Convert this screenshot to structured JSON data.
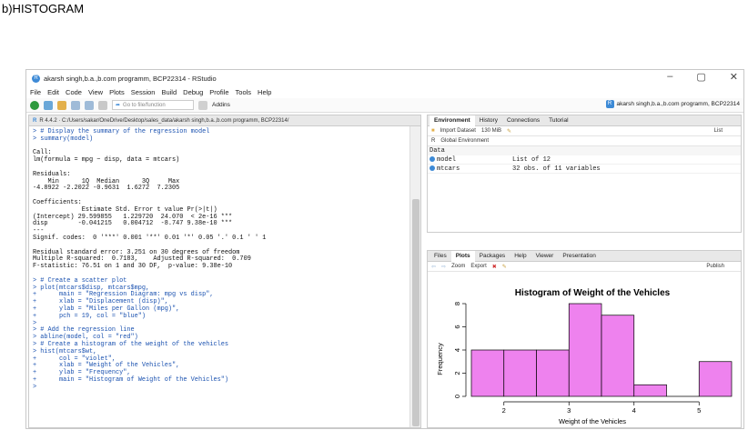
{
  "doc_heading": "b)HISTOGRAM",
  "window": {
    "title": "akarsh singh,b.a.,b.com programm, BCP22314 - RStudio",
    "controls": [
      "–",
      "▢",
      "✕"
    ]
  },
  "menu": [
    "File",
    "Edit",
    "Code",
    "View",
    "Plots",
    "Session",
    "Build",
    "Debug",
    "Profile",
    "Tools",
    "Help"
  ],
  "toolbar": {
    "goto_placeholder": "Go to file/function",
    "addins": "Addins",
    "project": "akarsh singh,b.a.,b.com programm, BCP22314"
  },
  "console": {
    "header": "R 4.4.2 · C:/Users/sakar/OneDrive/Desktop/sales_data/akarsh singh,b.a.,b.com programm, BCP22314/",
    "lines": [
      {
        "t": "> # Display the summary of the regression model",
        "k": "in"
      },
      {
        "t": "> summary(model)",
        "k": "in"
      },
      {
        "t": "",
        "k": "out"
      },
      {
        "t": "Call:",
        "k": "out"
      },
      {
        "t": "lm(formula = mpg ~ disp, data = mtcars)",
        "k": "out"
      },
      {
        "t": "",
        "k": "out"
      },
      {
        "t": "Residuals:",
        "k": "out"
      },
      {
        "t": "    Min      1Q  Median      3Q     Max ",
        "k": "out"
      },
      {
        "t": "-4.8922 -2.2022 -0.9631  1.6272  7.2305 ",
        "k": "out"
      },
      {
        "t": "",
        "k": "out"
      },
      {
        "t": "Coefficients:",
        "k": "out"
      },
      {
        "t": "             Estimate Std. Error t value Pr(>|t|)    ",
        "k": "out"
      },
      {
        "t": "(Intercept) 29.599855   1.229720  24.070  < 2e-16 ***",
        "k": "out"
      },
      {
        "t": "disp        -0.041215   0.004712  -8.747 9.38e-10 ***",
        "k": "out"
      },
      {
        "t": "---",
        "k": "out"
      },
      {
        "t": "Signif. codes:  0 '***' 0.001 '**' 0.01 '*' 0.05 '.' 0.1 ' ' 1",
        "k": "out"
      },
      {
        "t": "",
        "k": "out"
      },
      {
        "t": "Residual standard error: 3.251 on 30 degrees of freedom",
        "k": "out"
      },
      {
        "t": "Multiple R-squared:  0.7183,\tAdjusted R-squared:  0.709 ",
        "k": "out"
      },
      {
        "t": "F-statistic: 76.51 on 1 and 30 DF,  p-value: 9.38e-10",
        "k": "out"
      },
      {
        "t": "",
        "k": "out"
      },
      {
        "t": "> # Create a scatter plot",
        "k": "in"
      },
      {
        "t": "> plot(mtcars$disp, mtcars$mpg,",
        "k": "in"
      },
      {
        "t": "+      main = \"Regression Diagram: mpg vs disp\",",
        "k": "in"
      },
      {
        "t": "+      xlab = \"Displacement (disp)\",",
        "k": "in"
      },
      {
        "t": "+      ylab = \"Miles per Gallon (mpg)\",",
        "k": "in"
      },
      {
        "t": "+      pch = 19, col = \"blue\")",
        "k": "in"
      },
      {
        "t": ">",
        "k": "in"
      },
      {
        "t": "> # Add the regression line",
        "k": "in"
      },
      {
        "t": "> abline(model, col = \"red\")",
        "k": "in"
      },
      {
        "t": "> # Create a histogram of the weight of the vehicles",
        "k": "in"
      },
      {
        "t": "> hist(mtcars$wt,",
        "k": "in"
      },
      {
        "t": "+      col = \"violet\",",
        "k": "in"
      },
      {
        "t": "+      xlab = \"Weight of the Vehicles\",",
        "k": "in"
      },
      {
        "t": "+      ylab = \"Frequency\",",
        "k": "in"
      },
      {
        "t": "+      main = \"Histogram of Weight of the Vehicles\")",
        "k": "in"
      },
      {
        "t": ">",
        "k": "in"
      }
    ]
  },
  "env": {
    "tabs": [
      "Environment",
      "History",
      "Connections",
      "Tutorial"
    ],
    "import_label": "Import Dataset",
    "memory": "130 MiB",
    "list_label": "List",
    "r_label": "R",
    "global_env": "Global Environment",
    "section": "Data",
    "rows": [
      {
        "name": "model",
        "value": "List of  12"
      },
      {
        "name": "mtcars",
        "value": "32 obs. of 11 variables"
      }
    ]
  },
  "plots": {
    "tabs": [
      "Files",
      "Plots",
      "Packages",
      "Help",
      "Viewer",
      "Presentation"
    ],
    "zoom": "Zoom",
    "export": "Export",
    "publish": "Publish"
  },
  "chart_data": {
    "type": "bar",
    "title": "Histogram of Weight of the Vehicles",
    "xlabel": "Weight of the Vehicles",
    "ylabel": "Frequency",
    "bin_edges": [
      1.5,
      2.0,
      2.5,
      3.0,
      3.5,
      4.0,
      4.5,
      5.0,
      5.5
    ],
    "values": [
      4,
      4,
      4,
      8,
      7,
      1,
      0,
      3
    ],
    "xticks": [
      "2",
      "3",
      "4",
      "5"
    ],
    "yticks": [
      "0",
      "2",
      "4",
      "6",
      "8"
    ],
    "xlim": [
      1.5,
      5.5
    ],
    "ylim": [
      0,
      8
    ],
    "bar_color": "#EE82EE"
  }
}
